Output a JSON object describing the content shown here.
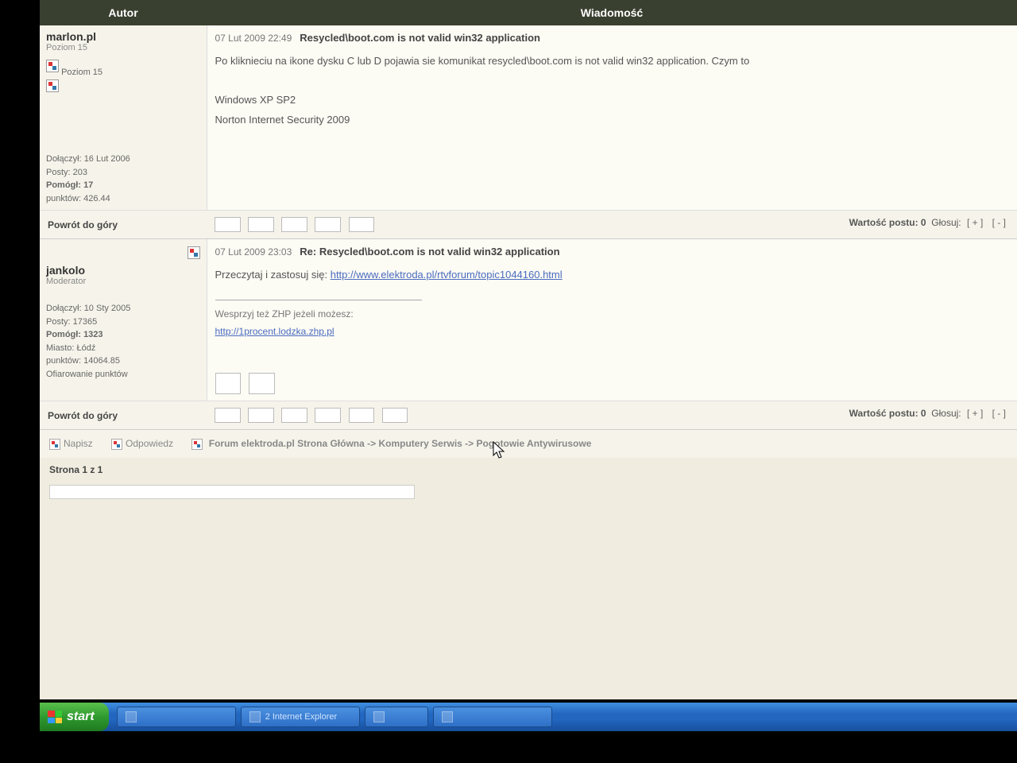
{
  "table": {
    "headers": {
      "author": "Autor",
      "message": "Wiadomość"
    }
  },
  "posts": [
    {
      "author": {
        "name": "marlon.pl",
        "rank": "Poziom 15",
        "badge": "Poziom 15",
        "joined_label": "Dołączył:",
        "joined": "16 Lut 2006",
        "posts_label": "Posty:",
        "posts": "203",
        "helped_label": "Pomógł:",
        "helped": "17",
        "points_label": "punktów:",
        "points": "426.44"
      },
      "date": "07 Lut 2009 22:49",
      "title": "Resycled\\boot.com is not valid win32 application",
      "body_line1": "Po kliknieciu na ikone dysku C lub D pojawia sie komunikat resycled\\boot.com is not valid win32 application. Czym to",
      "body_line2": "Windows XP SP2",
      "body_line3": "Norton Internet Security 2009",
      "back_top": "Powrót do góry",
      "vote_label": "Wartość postu:",
      "vote_value": "0",
      "vote_text": "Głosuj:",
      "vote_plus": "[ + ]",
      "vote_minus": "[ - ]"
    },
    {
      "author": {
        "name": "jankolo",
        "rank": "Moderator",
        "joined_label": "Dołączył:",
        "joined": "10 Sty 2005",
        "posts_label": "Posty:",
        "posts": "17365",
        "helped_label": "Pomógł:",
        "helped": "1323",
        "city_label": "Miasto:",
        "city": "Łódź",
        "points_label": "punktów:",
        "points": "14064.85",
        "donate": "Ofiarowanie punktów"
      },
      "date": "07 Lut 2009 23:03",
      "title": "Re: Resycled\\boot.com is not valid win32 application",
      "body_text": "Przeczytaj i zastosuj się: ",
      "body_link": "http://www.elektroda.pl/rtvforum/topic1044160.html",
      "sig_text": "Wesprzyj też ZHP jeżeli możesz:",
      "sig_link": "http://1procent.lodzka.zhp.pl",
      "back_top": "Powrót do góry",
      "vote_label": "Wartość postu:",
      "vote_value": "0",
      "vote_text": "Głosuj:",
      "vote_plus": "[ + ]",
      "vote_minus": "[ - ]"
    }
  ],
  "bottom": {
    "reply": "Napisz",
    "respond": "Odpowiedz",
    "breadcrumb": "Forum elektroda.pl Strona Główna -> Komputery Serwis -> Pogotowie Antywirusowe",
    "page_label": "Strona 1 z 1"
  },
  "taskbar": {
    "start": "start",
    "items": [
      "",
      "2 Internet Explorer",
      "",
      ""
    ]
  }
}
